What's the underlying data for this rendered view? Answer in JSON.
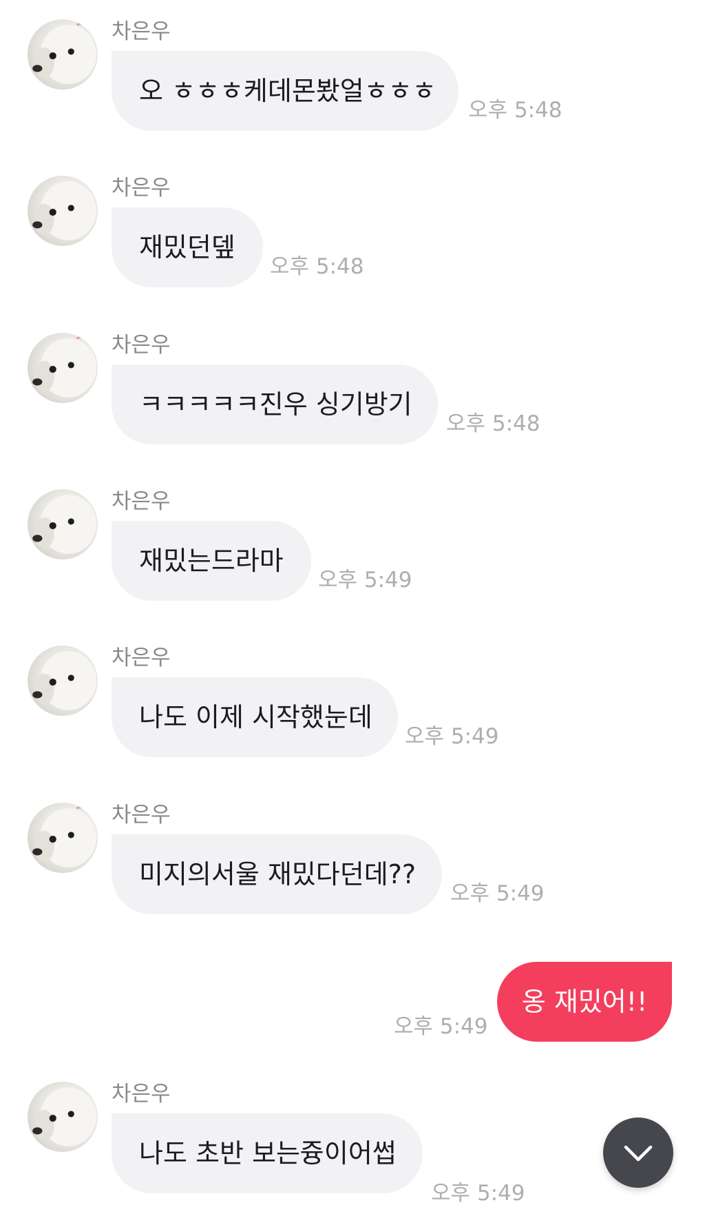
{
  "chat": {
    "sender_name": "차은우",
    "messages": [
      {
        "text": "오 ㅎㅎㅎ케데몬봤얼ㅎㅎㅎ",
        "time": "오후 5:48"
      },
      {
        "text": "재밌던뎊",
        "time": "오후 5:48"
      },
      {
        "text": "ㅋㅋㅋㅋㅋ진우 싱기방기",
        "time": "오후 5:48"
      },
      {
        "text": "재밌는드라마",
        "time": "오후 5:49"
      },
      {
        "text": "나도 이제 시작했눈데",
        "time": "오후 5:49"
      },
      {
        "text": "미지의서울 재밌다던데??",
        "time": "오후 5:49"
      }
    ],
    "my_message": {
      "text": "옹 재밌어!!",
      "time": "오후 5:49"
    },
    "last_message": {
      "text": "나도 초반 보는즁이어썹",
      "time": "오후 5:49"
    }
  },
  "icons": {
    "avatar": "dog-avatar-icon",
    "scroll": "chevron-down-icon"
  },
  "colors": {
    "incoming_bubble": "#f2f2f4",
    "outgoing_bubble": "#f43e5d",
    "scroll_button": "#46474c",
    "timestamp": "#aeaeb2",
    "sender_name": "#8a8a8e"
  }
}
